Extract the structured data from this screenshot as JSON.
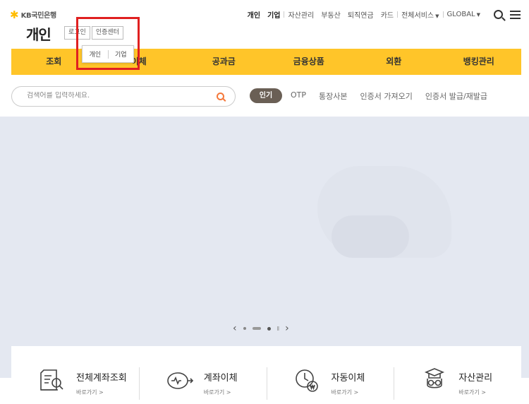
{
  "brand": {
    "logo_text": "KB국민은행"
  },
  "header": {
    "page_title": "개인",
    "login_label": "로그인",
    "cert_center_label": "인증센터",
    "dropdown": {
      "personal": "개인",
      "business": "기업"
    }
  },
  "top_util": {
    "personal": "개인",
    "business": "기업",
    "asset": "자산관리",
    "realestate": "부동산",
    "pension": "퇴직연금",
    "card": "카드",
    "all_services": "전체서비스",
    "global": "GLOBAL"
  },
  "gnb": {
    "items": [
      "조회",
      "이체",
      "공과금",
      "금융상품",
      "외환",
      "뱅킹관리"
    ]
  },
  "search": {
    "placeholder": "검색어를 입력하세요.",
    "popular_label": "인기",
    "keywords": [
      "OTP",
      "통장사본",
      "인증서 가져오기",
      "인증서 발급/재발급"
    ]
  },
  "quick_links": [
    {
      "title": "전체계좌조회",
      "sub": "바로가기 >"
    },
    {
      "title": "계좌이체",
      "sub": "바로가기 >"
    },
    {
      "title": "자동이체",
      "sub": "바로가기 >"
    },
    {
      "title": "자산관리",
      "sub": "바로가기 >"
    }
  ],
  "colors": {
    "brand_yellow": "#ffc529",
    "highlight_red": "#e02020",
    "badge_brown": "#6a5f55",
    "search_orange": "#f5783a"
  }
}
